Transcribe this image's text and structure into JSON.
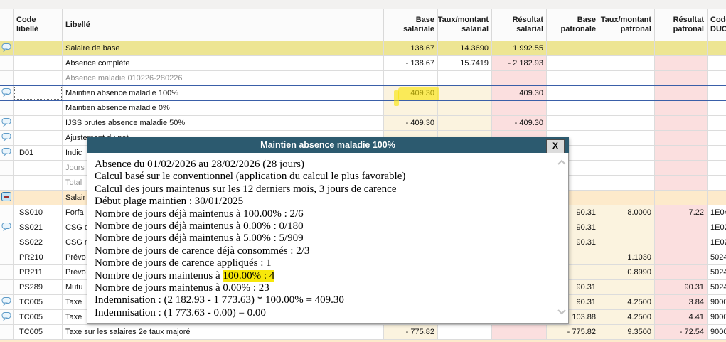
{
  "colors": {
    "row_highlight_yellow": "#EDE593",
    "section_row_orange": "#FDEACB",
    "editable_cell_cream": "#FBF3DF",
    "result_cell_pink": "#FBDFDF",
    "selection_line_blue": "#3A5FA8",
    "modal_titlebar_teal": "#2C5A6F",
    "annotation_marker_yellow": "#F7E704"
  },
  "table": {
    "columns": [
      {
        "l1": "",
        "l2": "",
        "align": "left"
      },
      {
        "l1": "Code",
        "l2": "libellé",
        "align": "left"
      },
      {
        "l1": "Libellé",
        "l2": "",
        "align": "left"
      },
      {
        "l1": "Base",
        "l2": "salariale",
        "align": "right"
      },
      {
        "l1": "Taux/montant",
        "l2": "salarial",
        "align": "right"
      },
      {
        "l1": "Résultat",
        "l2": "salarial",
        "align": "right"
      },
      {
        "l1": "Base",
        "l2": "patronale",
        "align": "right"
      },
      {
        "l1": "Taux/montant",
        "l2": "patronal",
        "align": "right"
      },
      {
        "l1": "Résultat",
        "l2": "patronal",
        "align": "right"
      },
      {
        "l1": "Code",
        "l2": "DUCS",
        "align": "left"
      }
    ],
    "rows": [
      {
        "icon": "comment",
        "code": "",
        "label": "Salaire de base",
        "type": "yellow",
        "cells": [
          {
            "v": "138.67",
            "bg": "yellow"
          },
          {
            "v": "14.3690",
            "bg": "yellow"
          },
          {
            "v": "1 992.55",
            "bg": "yellow"
          },
          {
            "v": "",
            "bg": "yellow"
          },
          {
            "v": "",
            "bg": "yellow"
          },
          {
            "v": "",
            "bg": "yellow"
          },
          {
            "v": "",
            "bg": "yellow"
          }
        ]
      },
      {
        "icon": null,
        "code": "",
        "label": "Absence complète",
        "type": "normal",
        "cells": [
          {
            "v": "- 138.67",
            "bg": "white"
          },
          {
            "v": "15.7419",
            "bg": "white"
          },
          {
            "v": "- 2 182.93",
            "bg": "pink"
          },
          {
            "v": "",
            "bg": "white"
          },
          {
            "v": "",
            "bg": "white"
          },
          {
            "v": "",
            "bg": "pink"
          },
          {
            "v": "",
            "bg": "white"
          }
        ]
      },
      {
        "icon": null,
        "code": "",
        "label": "Absence maladie 010226-280226",
        "type": "normal",
        "label_gray": true,
        "cells": [
          {
            "v": "",
            "bg": "white"
          },
          {
            "v": "",
            "bg": "white"
          },
          {
            "v": "",
            "bg": "pink"
          },
          {
            "v": "",
            "bg": "white"
          },
          {
            "v": "",
            "bg": "white"
          },
          {
            "v": "",
            "bg": "pink"
          },
          {
            "v": "",
            "bg": "white"
          }
        ]
      },
      {
        "icon": "comment",
        "code": "",
        "label": "Maintien absence maladie 100%",
        "type": "selected",
        "cells": [
          {
            "v": "409.30",
            "bg": "cream"
          },
          {
            "v": "",
            "bg": "cream"
          },
          {
            "v": "409.30",
            "bg": "pink"
          },
          {
            "v": "",
            "bg": "white"
          },
          {
            "v": "",
            "bg": "white"
          },
          {
            "v": "",
            "bg": "pink"
          },
          {
            "v": "",
            "bg": "white"
          }
        ]
      },
      {
        "icon": null,
        "code": "",
        "label": "Maintien absence maladie 0%",
        "type": "normal",
        "cells": [
          {
            "v": "",
            "bg": "cream"
          },
          {
            "v": "",
            "bg": "cream"
          },
          {
            "v": "",
            "bg": "pink"
          },
          {
            "v": "",
            "bg": "white"
          },
          {
            "v": "",
            "bg": "white"
          },
          {
            "v": "",
            "bg": "pink"
          },
          {
            "v": "",
            "bg": "white"
          }
        ]
      },
      {
        "icon": "comment",
        "code": "",
        "label": "IJSS brutes absence maladie 50%",
        "type": "normal",
        "cells": [
          {
            "v": "- 409.30",
            "bg": "cream"
          },
          {
            "v": "",
            "bg": "cream"
          },
          {
            "v": "- 409.30",
            "bg": "pink"
          },
          {
            "v": "",
            "bg": "white"
          },
          {
            "v": "",
            "bg": "white"
          },
          {
            "v": "",
            "bg": "pink"
          },
          {
            "v": "",
            "bg": "white"
          }
        ]
      },
      {
        "icon": "comment",
        "code": "",
        "label": "Ajustement du net",
        "type": "normal",
        "cells": [
          {
            "v": "",
            "bg": "cream"
          },
          {
            "v": "",
            "bg": "cream"
          },
          {
            "v": "",
            "bg": "pink"
          },
          {
            "v": "",
            "bg": "white"
          },
          {
            "v": "",
            "bg": "white"
          },
          {
            "v": "",
            "bg": "pink"
          },
          {
            "v": "",
            "bg": "white"
          }
        ]
      },
      {
        "icon": "comment",
        "code": "D01",
        "label": "Indic",
        "type": "normal",
        "cells": [
          {
            "v": "",
            "bg": "cream"
          },
          {
            "v": "",
            "bg": "cream"
          },
          {
            "v": "",
            "bg": "pink"
          },
          {
            "v": "",
            "bg": "white"
          },
          {
            "v": "",
            "bg": "white"
          },
          {
            "v": "",
            "bg": "pink"
          },
          {
            "v": "",
            "bg": "white"
          }
        ]
      },
      {
        "icon": null,
        "code": "",
        "label": "Jours",
        "type": "normal",
        "label_gray": true,
        "cells": [
          {
            "v": "",
            "bg": "cream"
          },
          {
            "v": "",
            "bg": "cream"
          },
          {
            "v": "",
            "bg": "pink"
          },
          {
            "v": "",
            "bg": "white"
          },
          {
            "v": "",
            "bg": "white"
          },
          {
            "v": "",
            "bg": "pink"
          },
          {
            "v": "",
            "bg": "white"
          }
        ]
      },
      {
        "icon": null,
        "code": "",
        "label": "Total",
        "type": "normal",
        "label_gray": true,
        "cells": [
          {
            "v": "",
            "bg": "cream"
          },
          {
            "v": "",
            "bg": "cream"
          },
          {
            "v": "",
            "bg": "pink"
          },
          {
            "v": "",
            "bg": "white"
          },
          {
            "v": "",
            "bg": "white"
          },
          {
            "v": "",
            "bg": "pink"
          },
          {
            "v": "",
            "bg": "white"
          }
        ]
      },
      {
        "icon": "collapse",
        "code": "",
        "label": "Salair",
        "type": "orange",
        "cells": [
          {
            "v": "",
            "bg": "orange"
          },
          {
            "v": "",
            "bg": "orange"
          },
          {
            "v": "",
            "bg": "orange"
          },
          {
            "v": "",
            "bg": "orange"
          },
          {
            "v": "",
            "bg": "orange"
          },
          {
            "v": "",
            "bg": "orange"
          },
          {
            "v": "",
            "bg": "orange"
          }
        ]
      },
      {
        "icon": null,
        "code": "SS010",
        "label": "Forfa",
        "type": "normal",
        "cells": [
          {
            "v": "",
            "bg": "cream"
          },
          {
            "v": "",
            "bg": "cream"
          },
          {
            "v": "",
            "bg": "pink"
          },
          {
            "v": "90.31",
            "bg": "cream"
          },
          {
            "v": "8.0000",
            "bg": "cream"
          },
          {
            "v": "7.22",
            "bg": "pink"
          },
          {
            "v": "1E04",
            "bg": "white"
          }
        ]
      },
      {
        "icon": "comment",
        "code": "SS021",
        "label": "CSG d",
        "type": "normal",
        "cells": [
          {
            "v": "",
            "bg": "cream"
          },
          {
            "v": "",
            "bg": "cream"
          },
          {
            "v": "",
            "bg": "pink"
          },
          {
            "v": "90.31",
            "bg": "cream"
          },
          {
            "v": "",
            "bg": "cream"
          },
          {
            "v": "",
            "bg": "pink"
          },
          {
            "v": "1E02",
            "bg": "white"
          }
        ]
      },
      {
        "icon": null,
        "code": "SS022",
        "label": "CSG n",
        "type": "normal",
        "cells": [
          {
            "v": "",
            "bg": "cream"
          },
          {
            "v": "",
            "bg": "cream"
          },
          {
            "v": "",
            "bg": "pink"
          },
          {
            "v": "90.31",
            "bg": "cream"
          },
          {
            "v": "",
            "bg": "cream"
          },
          {
            "v": "",
            "bg": "pink"
          },
          {
            "v": "1E02",
            "bg": "white"
          }
        ]
      },
      {
        "icon": null,
        "code": "PR210",
        "label": "Prévo",
        "type": "normal",
        "cells": [
          {
            "v": "",
            "bg": "cream"
          },
          {
            "v": "",
            "bg": "cream"
          },
          {
            "v": "",
            "bg": "pink"
          },
          {
            "v": "",
            "bg": "cream"
          },
          {
            "v": "1.1030",
            "bg": "cream"
          },
          {
            "v": "",
            "bg": "pink"
          },
          {
            "v": "5024",
            "bg": "white"
          }
        ]
      },
      {
        "icon": null,
        "code": "PR211",
        "label": "Prévo",
        "type": "normal",
        "cells": [
          {
            "v": "",
            "bg": "cream"
          },
          {
            "v": "",
            "bg": "cream"
          },
          {
            "v": "",
            "bg": "pink"
          },
          {
            "v": "",
            "bg": "cream"
          },
          {
            "v": "0.8990",
            "bg": "cream"
          },
          {
            "v": "",
            "bg": "pink"
          },
          {
            "v": "5024",
            "bg": "white"
          }
        ]
      },
      {
        "icon": null,
        "code": "PS289",
        "label": "Mutu",
        "type": "normal",
        "cells": [
          {
            "v": "",
            "bg": "cream"
          },
          {
            "v": "",
            "bg": "cream"
          },
          {
            "v": "",
            "bg": "pink"
          },
          {
            "v": "90.31",
            "bg": "cream"
          },
          {
            "v": "",
            "bg": "cream"
          },
          {
            "v": "90.31",
            "bg": "pink"
          },
          {
            "v": "5024",
            "bg": "white"
          }
        ]
      },
      {
        "icon": "comment",
        "code": "TC005",
        "label": "Taxe",
        "type": "normal",
        "cells": [
          {
            "v": "",
            "bg": "cream"
          },
          {
            "v": "",
            "bg": "cream"
          },
          {
            "v": "",
            "bg": "pink"
          },
          {
            "v": "90.31",
            "bg": "cream"
          },
          {
            "v": "4.2500",
            "bg": "cream"
          },
          {
            "v": "3.84",
            "bg": "pink"
          },
          {
            "v": "9000",
            "bg": "white"
          }
        ]
      },
      {
        "icon": "comment",
        "code": "TC005",
        "label": "Taxe",
        "type": "normal",
        "cells": [
          {
            "v": "",
            "bg": "cream"
          },
          {
            "v": "",
            "bg": "cream"
          },
          {
            "v": "",
            "bg": "pink"
          },
          {
            "v": "103.88",
            "bg": "cream"
          },
          {
            "v": "4.2500",
            "bg": "cream"
          },
          {
            "v": "4.41",
            "bg": "pink"
          },
          {
            "v": "9000",
            "bg": "white"
          }
        ]
      },
      {
        "icon": null,
        "code": "TC005",
        "label": "Taxe sur les salaires 2e taux majoré",
        "type": "normal",
        "cells": [
          {
            "v": "- 775.82",
            "bg": "cream"
          },
          {
            "v": "",
            "bg": "white"
          },
          {
            "v": "",
            "bg": "pink"
          },
          {
            "v": "- 775.82",
            "bg": "cream"
          },
          {
            "v": "9.3500",
            "bg": "cream"
          },
          {
            "v": "- 72.54",
            "bg": "pink"
          },
          {
            "v": "9000",
            "bg": "white"
          }
        ]
      }
    ]
  },
  "modal": {
    "title": "Maintien absence maladie 100%",
    "close_label": "X",
    "lines": [
      {
        "t": "Absence du 01/02/2026 au 28/02/2026 (28 jours)"
      },
      {
        "t": "Calcul basé sur le conventionnel (application du calcul le plus favorable)"
      },
      {
        "t": "Calcul des jours maintenus sur les 12 derniers mois, 3 jours de carence"
      },
      {
        "t": "Début plage maintien : 30/01/2025"
      },
      {
        "t": "Nombre de jours déjà maintenus à 100.00% : 2/6"
      },
      {
        "t": "Nombre de jours déjà maintenus à 0.00% : 0/180"
      },
      {
        "t": "Nombre de jours déjà maintenus à 5.00% : 5/909"
      },
      {
        "t": "Nombre de jours de carence déjà consommés : 2/3"
      },
      {
        "t": "Nombre de jours de carence appliqués : 1"
      },
      {
        "t": "Nombre de jours maintenus à ",
        "hl": "100.00% : 4"
      },
      {
        "t": "Nombre de jours maintenus à 0.00% : 23"
      },
      {
        "t": "Indemnisation : (2 182.93 - 1 773.63) * 100.00% = 409.30"
      },
      {
        "t": "Indemnisation : (1 773.63 - 0.00) = 0.00"
      }
    ]
  }
}
